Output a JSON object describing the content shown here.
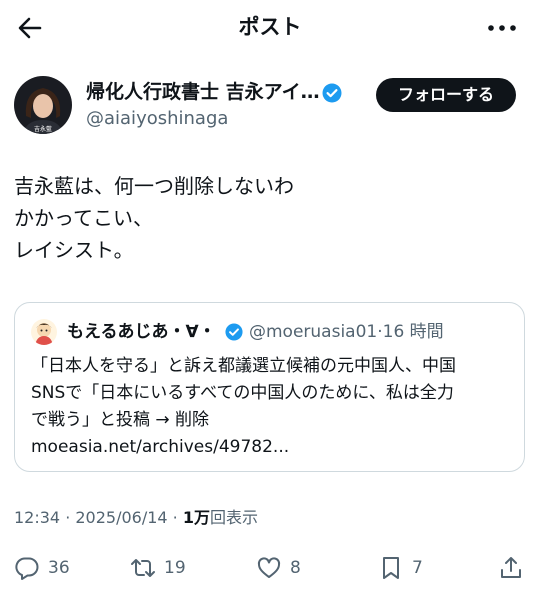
{
  "header": {
    "title": "ポスト"
  },
  "author": {
    "name": "帰化人行政書士 吉永アイ…",
    "handle": "@aiaiyoshinaga",
    "avatar_caption": "吉永藍"
  },
  "follow_button": {
    "label": "フォローする"
  },
  "tweet": {
    "lines": [
      "吉永藍は、何一つ削除しないわ",
      "かかってこい、",
      "レイシスト。"
    ]
  },
  "quote": {
    "name": "もえるあじあ・∀・",
    "handle": "@moeruasia01",
    "separator": "·",
    "time": "16 時間",
    "lines": [
      "「日本人を守る」と訴え都議選立候補の元中国人、中国",
      "SNSで「日本にいるすべての中国人のために、私は全力",
      "で戦う」と投稿 → 削除",
      "moeasia.net/archives/49782..."
    ]
  },
  "meta": {
    "time": "12:34",
    "dot1": " · ",
    "date": "2025/06/14",
    "dot2": " · ",
    "views_count": "1万",
    "views_label": "回表示"
  },
  "actions": {
    "reply_count": "36",
    "retweet_count": "19",
    "like_count": "8",
    "bookmark_count": "7"
  },
  "colors": {
    "text": "#0f1419",
    "secondary": "#536471",
    "verified": "#1d9bf0",
    "border": "#cfd9de"
  }
}
